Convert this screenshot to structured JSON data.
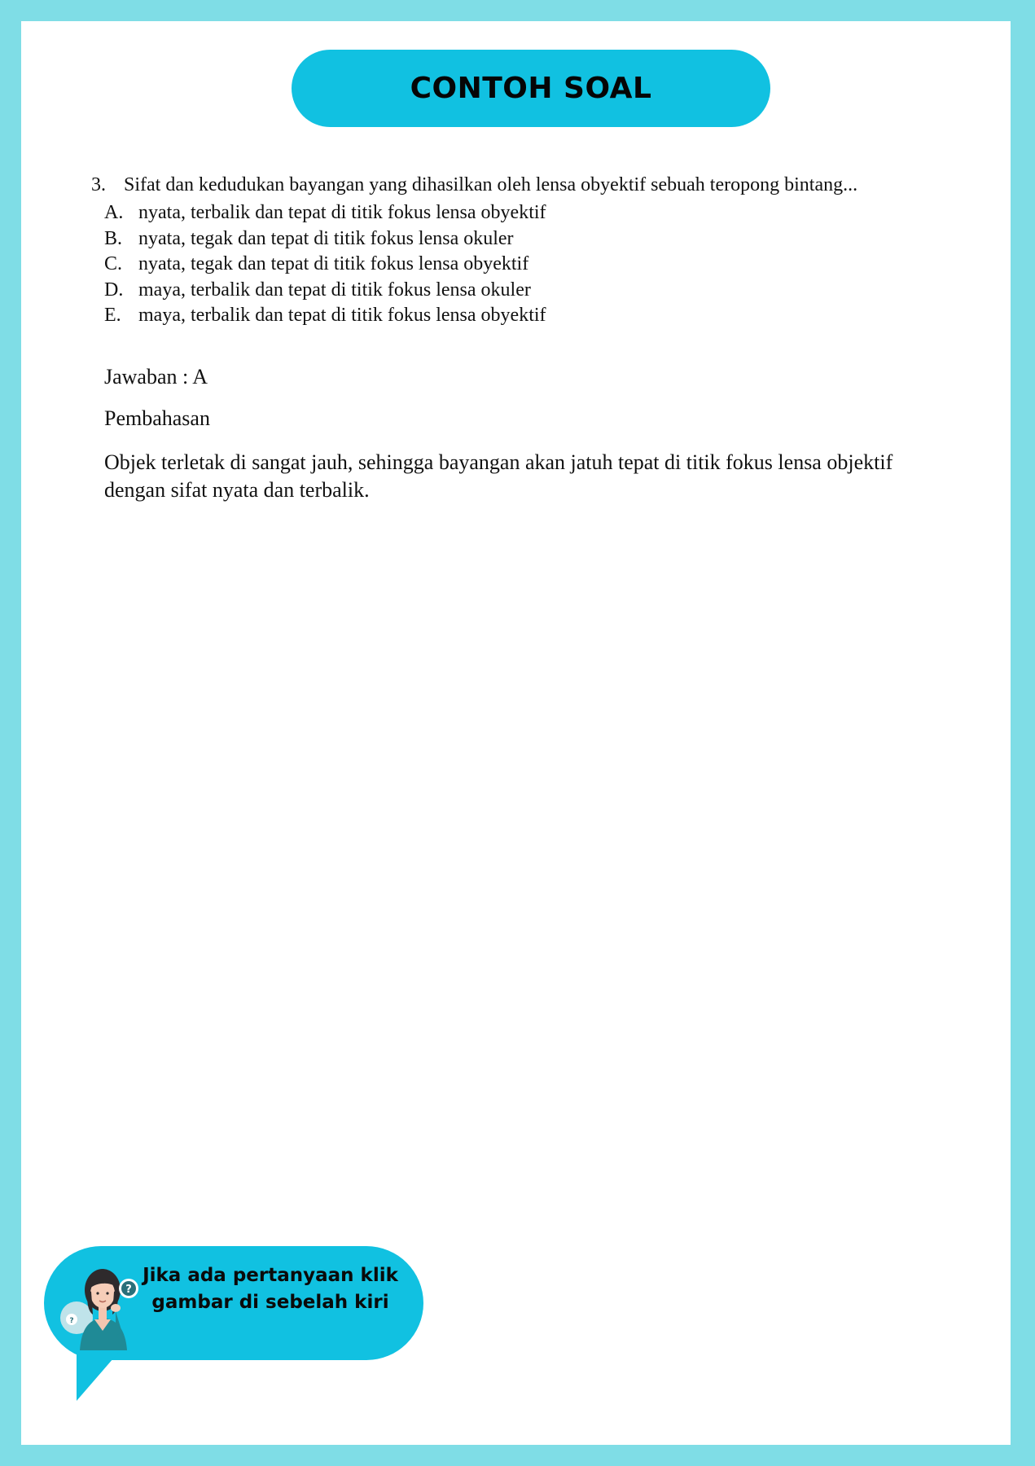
{
  "header": {
    "title": "CONTOH SOAL"
  },
  "question": {
    "number": "3.",
    "text": "Sifat dan kedudukan bayangan yang dihasilkan oleh lensa obyektif sebuah teropong bintang...",
    "options": [
      {
        "letter": "A.",
        "text": "nyata, terbalik dan tepat di titik fokus lensa obyektif"
      },
      {
        "letter": "B.",
        "text": "nyata, tegak dan tepat di titik fokus lensa okuler"
      },
      {
        "letter": "C.",
        "text": "nyata, tegak dan tepat di titik fokus lensa obyektif"
      },
      {
        "letter": "D.",
        "text": "maya, terbalik dan tepat di titik fokus lensa okuler"
      },
      {
        "letter": "E.",
        "text": "maya, terbalik dan tepat di titik fokus lensa obyektif"
      }
    ]
  },
  "answer": "Jawaban : A",
  "explanation": {
    "title": "Pembahasan",
    "body": "Objek terletak di sangat jauh, sehingga bayangan akan jatuh tepat di titik fokus lensa objektif dengan sifat nyata dan terbalik."
  },
  "help": {
    "line1": "Jika ada pertanyaan klik",
    "line2": "gambar di sebelah kiri",
    "icon": "woman-question-icon"
  },
  "colors": {
    "border": "#7fdde6",
    "accent": "#11c1e1",
    "page": "#ffffff"
  }
}
